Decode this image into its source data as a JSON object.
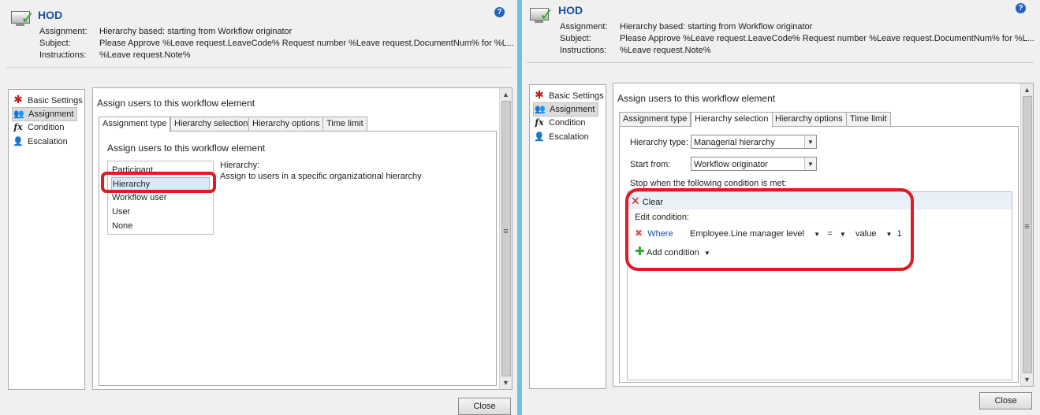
{
  "left_dialog": {
    "title": "HOD",
    "help_icon": "?",
    "fields": {
      "assignment_label": "Assignment:",
      "assignment_value": "Hierarchy based: starting from Workflow originator",
      "subject_label": "Subject:",
      "subject_value": "Please Approve %Leave request.LeaveCode% Request number %Leave request.DocumentNum% for %L...",
      "instructions_label": "Instructions:",
      "instructions_value": "%Leave request.Note%"
    },
    "nav": [
      {
        "label": "Basic Settings",
        "icon": "asterisk-icon"
      },
      {
        "label": "Assignment",
        "icon": "users-icon",
        "selected": true
      },
      {
        "label": "Condition",
        "icon": "fx-icon"
      },
      {
        "label": "Escalation",
        "icon": "escalation-icon"
      }
    ],
    "main_heading": "Assign users to this workflow element",
    "tabs": [
      "Assignment type",
      "Hierarchy selection",
      "Hierarchy options",
      "Time limit"
    ],
    "active_tab": "Assignment type",
    "panel_heading": "Assign users to this workflow element",
    "assignment_options": [
      "Participant",
      "Hierarchy",
      "Workflow user",
      "User",
      "None"
    ],
    "selected_option": "Hierarchy",
    "description_title": "Hierarchy:",
    "description_text": "Assign to users in a specific organizational hierarchy",
    "close_label": "Close"
  },
  "right_dialog": {
    "title": "HOD",
    "help_icon": "?",
    "fields": {
      "assignment_label": "Assignment:",
      "assignment_value": "Hierarchy based: starting from Workflow originator",
      "subject_label": "Subject:",
      "subject_value": "Please Approve %Leave request.LeaveCode% Request number %Leave request.DocumentNum% for %L...",
      "instructions_label": "Instructions:",
      "instructions_value": "%Leave request.Note%"
    },
    "nav": [
      {
        "label": "Basic Settings",
        "icon": "asterisk-icon"
      },
      {
        "label": "Assignment",
        "icon": "users-icon",
        "selected": true
      },
      {
        "label": "Condition",
        "icon": "fx-icon"
      },
      {
        "label": "Escalation",
        "icon": "escalation-icon"
      }
    ],
    "main_heading": "Assign users to this workflow element",
    "tabs": [
      "Assignment type",
      "Hierarchy selection",
      "Hierarchy options",
      "Time limit"
    ],
    "active_tab": "Hierarchy selection",
    "hierarchy_type_label": "Hierarchy type:",
    "hierarchy_type_value": "Managerial hierarchy",
    "start_from_label": "Start from:",
    "start_from_value": "Workflow originator",
    "stop_label": "Stop when the following condition is met:",
    "condition": {
      "clear_label": "Clear",
      "edit_label": "Edit condition:",
      "where_label": "Where",
      "field": "Employee.Line manager level",
      "operator": "=",
      "value_type": "value",
      "value": "1",
      "add_label": "Add condition"
    },
    "close_label": "Close"
  },
  "colors": {
    "annotation_red": "#e01b24",
    "title_blue": "#1c4e9f",
    "background_blue": "#6fc0e4"
  }
}
